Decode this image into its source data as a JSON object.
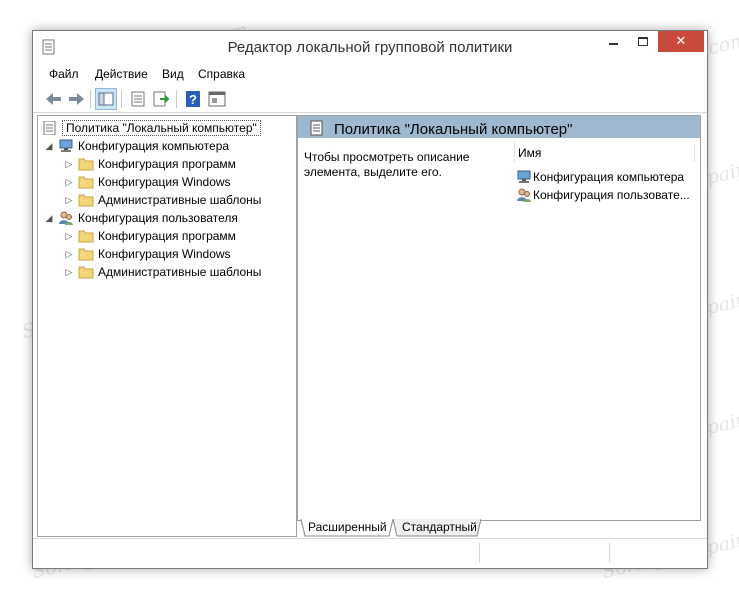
{
  "window": {
    "title": "Редактор локальной групповой политики",
    "close_glyph": "✕"
  },
  "menu": [
    "Файл",
    "Действие",
    "Вид",
    "Справка"
  ],
  "toolbar": {
    "icons": [
      "back-arrow-icon",
      "forward-arrow-icon",
      "show-tree-icon",
      "properties-icon",
      "export-list-icon",
      "help-icon",
      "console-icon"
    ],
    "help_glyph": "?"
  },
  "tree": {
    "root": "Политика \"Локальный компьютер\"",
    "computer": {
      "label": "Конфигурация компьютера",
      "children": [
        "Конфигурация программ",
        "Конфигурация Windows",
        "Административные шаблоны"
      ]
    },
    "user": {
      "label": "Конфигурация пользователя",
      "children": [
        "Конфигурация программ",
        "Конфигурация Windows",
        "Административные шаблоны"
      ]
    },
    "expanded_glyph": "◢",
    "collapsed_glyph": "▷"
  },
  "details": {
    "title": "Политика \"Локальный компьютер\"",
    "description": "Чтобы просмотреть описание элемента, выделите его.",
    "column_name": "Имя",
    "items": [
      "Конфигурация компьютера",
      "Конфигурация пользовате..."
    ]
  },
  "tabs": [
    "Расширенный",
    "Стандартный"
  ],
  "watermark": "Soringpcrepair.com",
  "colors": {
    "header_bar": "#9db8cf",
    "close_button": "#c74a3c",
    "folder": "#f4d57a",
    "active_toolbar": "#cde4f7"
  }
}
